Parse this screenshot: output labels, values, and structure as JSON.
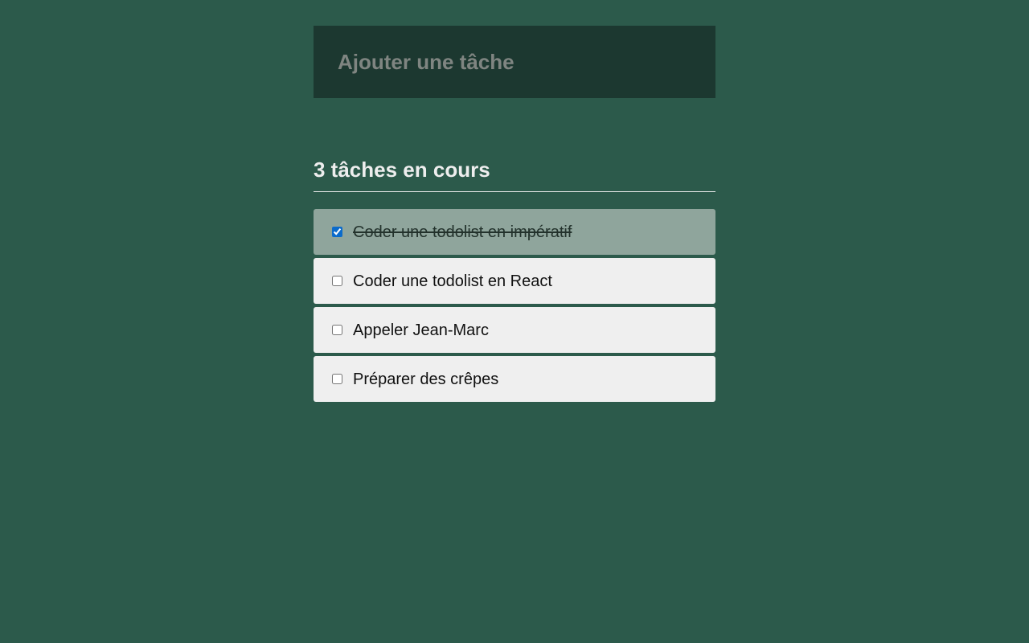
{
  "new_task": {
    "placeholder": "Ajouter une tâche",
    "value": ""
  },
  "summary": {
    "heading": "3 tâches en cours"
  },
  "tasks": [
    {
      "label": "Coder une todolist en impératif",
      "done": true
    },
    {
      "label": "Coder une todolist en React",
      "done": false
    },
    {
      "label": "Appeler Jean-Marc",
      "done": false
    },
    {
      "label": "Préparer des crêpes",
      "done": false
    }
  ],
  "colors": {
    "background": "#2c5a4b",
    "input_background": "#1c3830",
    "task_background": "#efefef",
    "task_done_background": "#8fa59c",
    "checkbox_accent": "#0b6bcb"
  }
}
